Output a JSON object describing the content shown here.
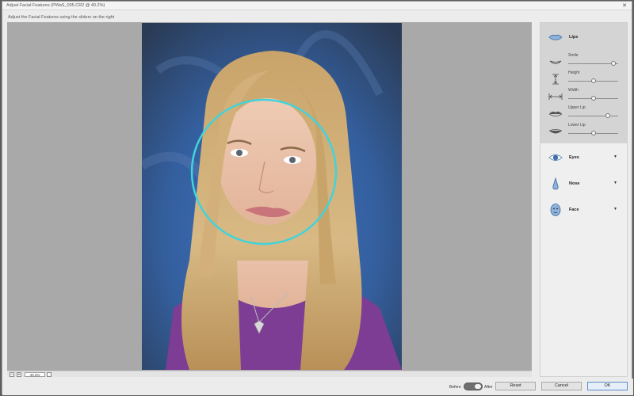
{
  "window": {
    "title": "Adjust Facial Features (PWaS_005.CR2 @ 40.2%)",
    "subtitle": "Adjust the Facial Features using the sliders on the right",
    "close_glyph": "✕"
  },
  "zoom": {
    "value": "40.2%",
    "zoom_out": "−",
    "zoom_in": "+"
  },
  "features": {
    "lips": {
      "title": "Lips",
      "icon": "lips-icon",
      "sliders": [
        {
          "label": "Smile",
          "icon": "smile-icon",
          "value": 0.95
        },
        {
          "label": "Height",
          "icon": "height-icon",
          "value": 0.5
        },
        {
          "label": "Width",
          "icon": "width-icon",
          "value": 0.5
        },
        {
          "label": "Upper Lip",
          "icon": "upper-lip-icon",
          "value": 0.8
        },
        {
          "label": "Lower Lip",
          "icon": "lower-lip-icon",
          "value": 0.5
        }
      ]
    },
    "eyes": {
      "title": "Eyes",
      "icon": "eye-icon",
      "arrow": "▼"
    },
    "nose": {
      "title": "Nose",
      "icon": "nose-icon",
      "arrow": "▼"
    },
    "face": {
      "title": "Face",
      "icon": "face-icon",
      "arrow": "▼"
    }
  },
  "footer": {
    "before_label": "Before",
    "after_label": "After",
    "reset_label": "Reset",
    "cancel_label": "Cancel",
    "ok_label": "OK"
  },
  "colors": {
    "face_circle": "#3fd4dc",
    "accent_blue": "#5b8fc9"
  }
}
